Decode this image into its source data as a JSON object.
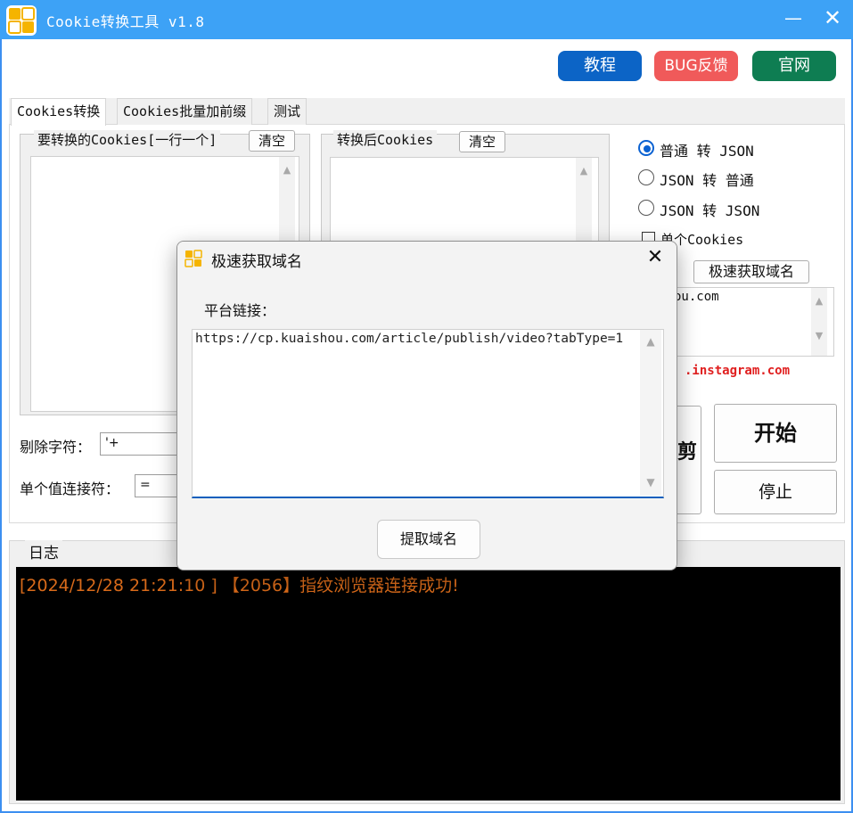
{
  "window": {
    "title": "Cookie转换工具 v1.8",
    "minimize_label": "—",
    "close_label": "✕"
  },
  "toolbar": {
    "tutorial_label": "教程",
    "bug_label": "BUG反馈",
    "site_label": "官网"
  },
  "colors": {
    "titlebar": "#3da2f6",
    "tutorial": "#0c64c6",
    "bug": "#f05a5a",
    "site": "#0e7d52",
    "log_text": "#d86a1a"
  },
  "tabs": [
    {
      "label": "Cookies转换",
      "active": true
    },
    {
      "label": "Cookies批量加前缀",
      "active": false
    },
    {
      "label": "测试",
      "active": false
    }
  ],
  "input_group": {
    "label": "要转换的Cookies[一行一个]",
    "clear_label": "清空",
    "value": ""
  },
  "output_group": {
    "label": "转换后Cookies",
    "clear_label": "清空",
    "value": ""
  },
  "options": {
    "radios": [
      {
        "label": "普通 转 JSON",
        "selected": true
      },
      {
        "label": "JSON 转 普通",
        "selected": false
      },
      {
        "label": "JSON 转 JSON",
        "selected": false
      }
    ],
    "single_cookie_label": "单个Cookies",
    "fast_domain_label": "极速获取域名",
    "domain_box_text": "ou.com",
    "domain_hint": ".instagram.com"
  },
  "fields": {
    "strip_chars_label": "剔除字符：",
    "strip_chars_value": "'+",
    "joiner_label": "单个值连接符：",
    "joiner_value": "="
  },
  "actions": {
    "partial_label": "剪",
    "start_label": "开始",
    "stop_label": "停止"
  },
  "log": {
    "label": "日志",
    "lines": [
      "[2024/12/28 21:21:10 ] 【2056】指纹浏览器连接成功!"
    ]
  },
  "dialog": {
    "title": "极速获取域名",
    "close_label": "✕",
    "url_label": "平台链接：",
    "url_value": "https://cp.kuaishou.com/article/publish/video?tabType=1",
    "extract_label": "提取域名"
  }
}
